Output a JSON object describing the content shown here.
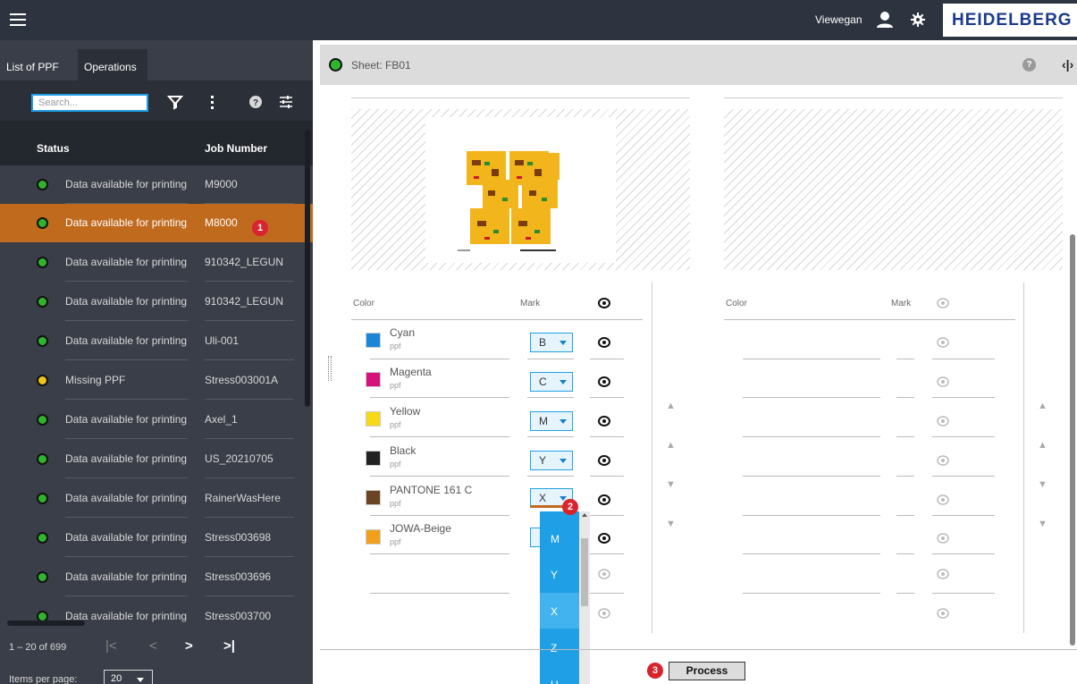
{
  "header": {
    "user_name": "Viewegan",
    "brand": "HEIDELBERG"
  },
  "left_panel": {
    "tabs": [
      "List of PPF",
      "Operations"
    ],
    "active_tab": "Operations",
    "search_placeholder": "Search...",
    "columns": {
      "status": "Status",
      "job_number": "Job Number"
    },
    "rows": [
      {
        "status": "Data available for printing",
        "job": "M9000",
        "state_color": "#2fb52b",
        "selected": false
      },
      {
        "status": "Data available for printing",
        "job": "M8000",
        "state_color": "#2fb52b",
        "selected": true
      },
      {
        "status": "Data available for printing",
        "job": "910342_LEGUN",
        "state_color": "#2fb52b",
        "selected": false
      },
      {
        "status": "Data available for printing",
        "job": "910342_LEGUN",
        "state_color": "#2fb52b",
        "selected": false
      },
      {
        "status": "Data available for printing",
        "job": "Uli-001",
        "state_color": "#2fb52b",
        "selected": false
      },
      {
        "status": "Missing PPF",
        "job": "Stress003001A",
        "state_color": "#f0c419",
        "selected": false
      },
      {
        "status": "Data available for printing",
        "job": "Axel_1",
        "state_color": "#2fb52b",
        "selected": false
      },
      {
        "status": "Data available for printing",
        "job": "US_20210705",
        "state_color": "#2fb52b",
        "selected": false
      },
      {
        "status": "Data available for printing",
        "job": "RainerWasHere",
        "state_color": "#2fb52b",
        "selected": false
      },
      {
        "status": "Data available for printing",
        "job": "Stress003698",
        "state_color": "#2fb52b",
        "selected": false
      },
      {
        "status": "Data available for printing",
        "job": "Stress003696",
        "state_color": "#2fb52b",
        "selected": false
      },
      {
        "status": "Data available for printing",
        "job": "Stress003700",
        "state_color": "#2fb52b",
        "selected": false
      }
    ],
    "paginator": {
      "range": "1 – 20 of 699",
      "items_per_page_label": "Items per page:",
      "items_per_page": "20"
    }
  },
  "sheet": {
    "label": "Sheet:",
    "name": "FB01"
  },
  "color_table": {
    "headers": {
      "color": "Color",
      "mark": "Mark"
    },
    "rows": [
      {
        "name": "Cyan",
        "source": "ppf",
        "mark": "B",
        "swatch": "#1c86d6"
      },
      {
        "name": "Magenta",
        "source": "ppf",
        "mark": "C",
        "swatch": "#d6137a"
      },
      {
        "name": "Yellow",
        "source": "ppf",
        "mark": "M",
        "swatch": "#f7d917"
      },
      {
        "name": "Black",
        "source": "ppf",
        "mark": "Y",
        "swatch": "#222222"
      },
      {
        "name": "PANTONE 161 C",
        "source": "ppf",
        "mark": "X",
        "swatch": "#6b4423"
      },
      {
        "name": "JOWA-Beige",
        "source": "ppf",
        "mark": "",
        "swatch": "#f0a01a"
      }
    ],
    "right_headers": {
      "color": "Color",
      "mark": "Mark"
    }
  },
  "mark_dropdown": {
    "options": [
      "M",
      "Y",
      "X",
      "Z",
      "U"
    ],
    "highlighted": "X"
  },
  "callouts": [
    "1",
    "2",
    "3"
  ],
  "process_button": "Process",
  "colors": {
    "accent": "#1fa0e6",
    "selected_row": "#c06a1e",
    "callout": "#d9232d"
  }
}
